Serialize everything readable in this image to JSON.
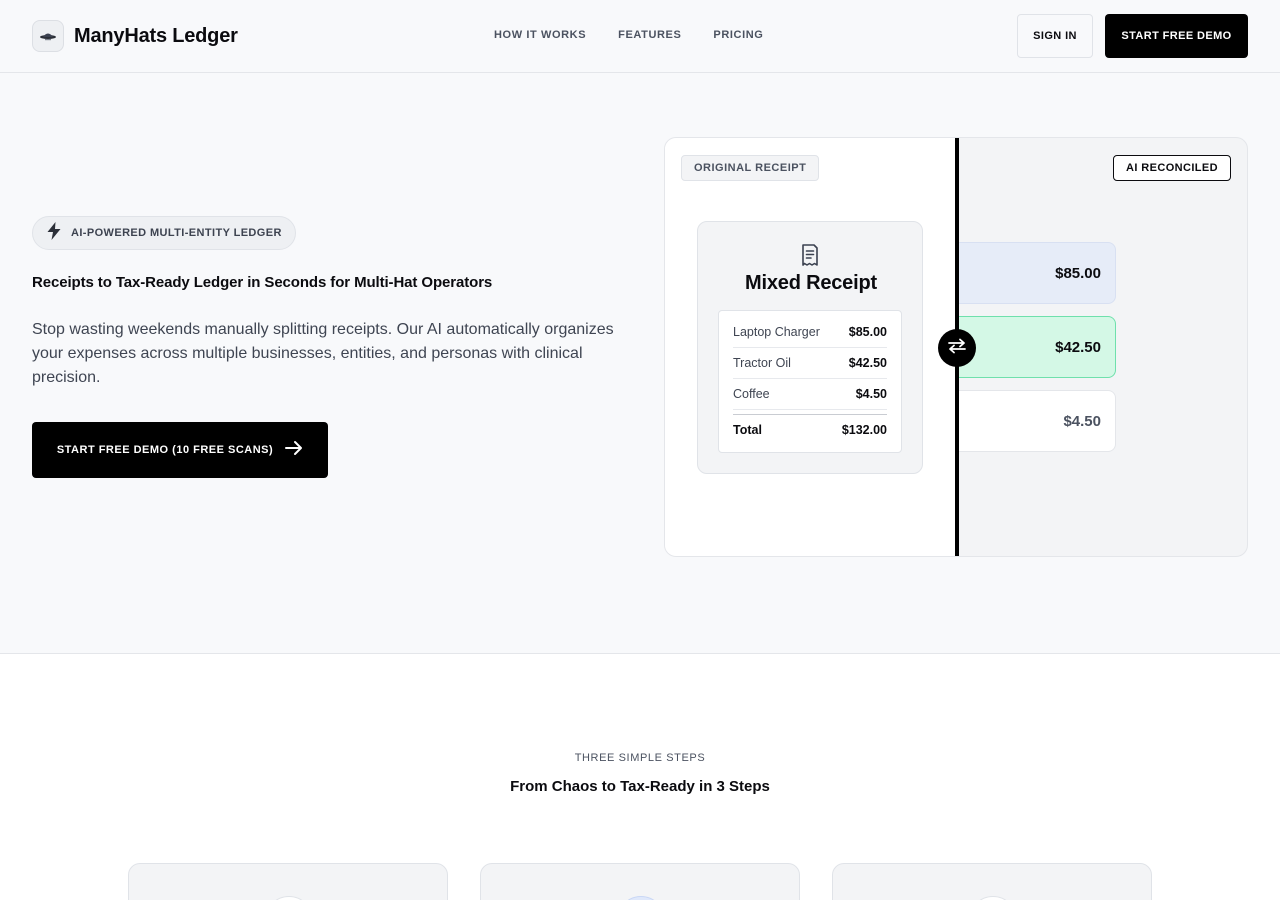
{
  "nav": {
    "brand": "ManyHats Ledger",
    "links": [
      "HOW IT WORKS",
      "FEATURES",
      "PRICING"
    ],
    "sign_in": "SIGN IN",
    "start_demo": "START FREE DEMO"
  },
  "hero": {
    "badge": "AI-POWERED MULTI-ENTITY LEDGER",
    "title": "Receipts to Tax-Ready Ledger in Seconds for Multi-Hat Operators",
    "description": "Stop wasting weekends manually splitting receipts. Our AI automatically organizes your expenses across multiple businesses, entities, and personas with clinical precision.",
    "cta": "START FREE DEMO (10 FREE SCANS)"
  },
  "compare": {
    "original_tag": "ORIGINAL RECEIPT",
    "ai_tag": "AI RECONCILED",
    "receipt_title": "Mixed Receipt",
    "items": [
      {
        "name": "Laptop Charger",
        "amount": "$85.00"
      },
      {
        "name": "Tractor Oil",
        "amount": "$42.50"
      },
      {
        "name": "Coffee",
        "amount": "$4.50"
      }
    ],
    "total_label": "Total",
    "total_amount": "$132.00",
    "reconciled": [
      "$85.00",
      "$42.50",
      "$4.50"
    ]
  },
  "steps": {
    "eyebrow": "THREE SIMPLE STEPS",
    "title": "From Chaos to Tax-Ready in 3 Steps"
  },
  "colors": {
    "accent_black": "#000000",
    "chip_blue": "#e6ecf8",
    "chip_green": "#d4f8e6",
    "chip_green_border": "#6fe0ac"
  }
}
